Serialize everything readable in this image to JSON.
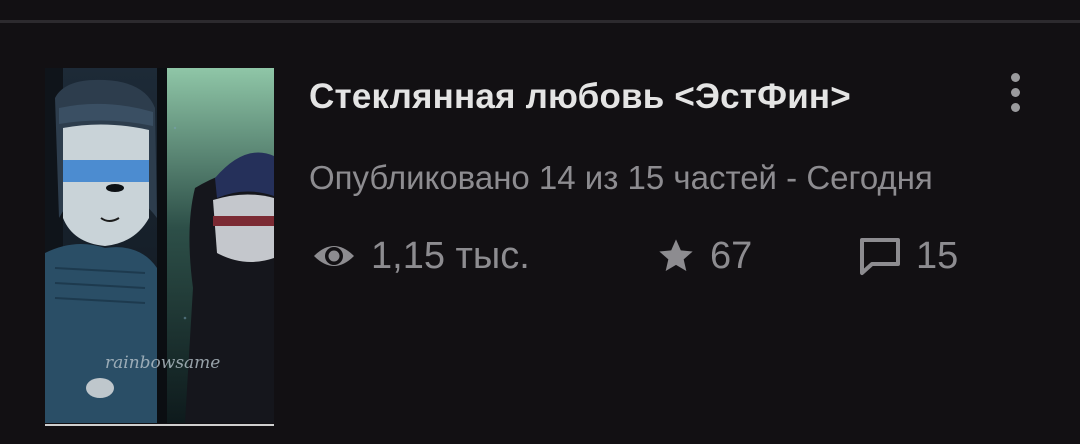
{
  "story": {
    "title": "Стеклянная любовь <ЭстФин>",
    "subtitle": "Опубликовано 14 из 15 частей - Сегодня",
    "cover": {
      "watermark": "rainbowsame",
      "palette": {
        "background": "#1a2230",
        "hood": "#2a4e66",
        "face": "#c9d3d8",
        "flag_blue": "#4c8cd0",
        "window_green": "#7fb89a",
        "dark_figure": "#15161c"
      }
    },
    "stats": {
      "reads_icon": "eye-icon",
      "reads": "1,15 тыс.",
      "votes_icon": "star-icon",
      "votes": "67",
      "comments_icon": "comment-icon",
      "comments": "15"
    },
    "more_icon": "more-vertical-icon"
  },
  "theme": {
    "background": "#121013",
    "title_color": "#e4e4e4",
    "secondary_text": "#8d8c90",
    "divider": "#2c2a2e"
  }
}
